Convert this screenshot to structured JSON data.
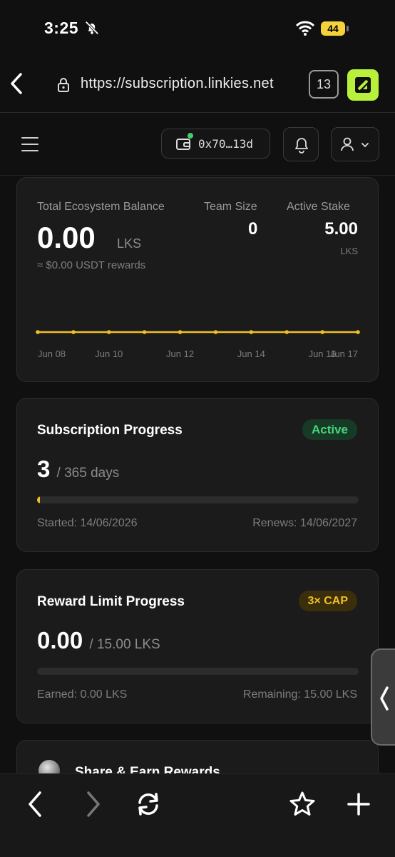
{
  "status_bar": {
    "time": "3:25",
    "battery": "44",
    "icons": [
      "bell-slash-icon",
      "wifi-icon",
      "battery-icon"
    ]
  },
  "browser": {
    "url": "https://subscription.linkies.net",
    "tab_count": "13",
    "icons": [
      "back-icon",
      "lock-icon",
      "tabs-icon",
      "extension-icon"
    ]
  },
  "app_header": {
    "wallet_address": "0x70…13d",
    "icons": [
      "menu-icon",
      "wallet-icon",
      "bell-icon",
      "user-icon",
      "chevron-down-icon"
    ]
  },
  "balance_card": {
    "total_label": "Total Ecosystem Balance",
    "total_value": "0.00",
    "total_unit": "LKS",
    "usd_note": "≈ $0.00 USDT rewards",
    "team_label": "Team Size",
    "team_value": "0",
    "stake_label": "Active Stake",
    "stake_value": "5.00",
    "stake_unit": "LKS"
  },
  "chart_data": {
    "type": "line",
    "x": [
      "Jun 08",
      "Jun 09",
      "Jun 10",
      "Jun 11",
      "Jun 12",
      "Jun 13",
      "Jun 14",
      "Jun 15",
      "Jun 16",
      "Jun 17"
    ],
    "tick_labels": [
      "Jun 08",
      "Jun 10",
      "Jun 12",
      "Jun 14",
      "Jun 16",
      "Jun 17"
    ],
    "series": [
      {
        "values": [
          0,
          0,
          0,
          0,
          0,
          0,
          0,
          0,
          0,
          0
        ]
      }
    ],
    "color": "#f2bf25",
    "title": "",
    "xlabel": "",
    "ylabel": "",
    "grid": false
  },
  "subscription_card": {
    "title": "Subscription Progress",
    "status": "Active",
    "days_done": "3",
    "days_total": "/ 365 days",
    "progress_fraction": 0.0082,
    "started": "Started: 14/06/2026",
    "renews": "Renews: 14/06/2027"
  },
  "reward_card": {
    "title": "Reward Limit Progress",
    "badge": "3× CAP",
    "earned_value": "0.00",
    "limit_text": "/ 15.00 LKS",
    "progress_fraction": 0,
    "earned": "Earned: 0.00 LKS",
    "remaining": "Remaining: 15.00 LKS"
  },
  "share_card": {
    "title": "Share & Earn Rewards"
  },
  "bottom_bar": {
    "icons": [
      "back-icon",
      "forward-icon",
      "reload-icon",
      "star-icon",
      "plus-icon"
    ]
  },
  "colors": {
    "accent": "#f2bf25",
    "active_green": "#48d47a",
    "extension": "#b8f03c",
    "battery": "#f6d23a"
  }
}
